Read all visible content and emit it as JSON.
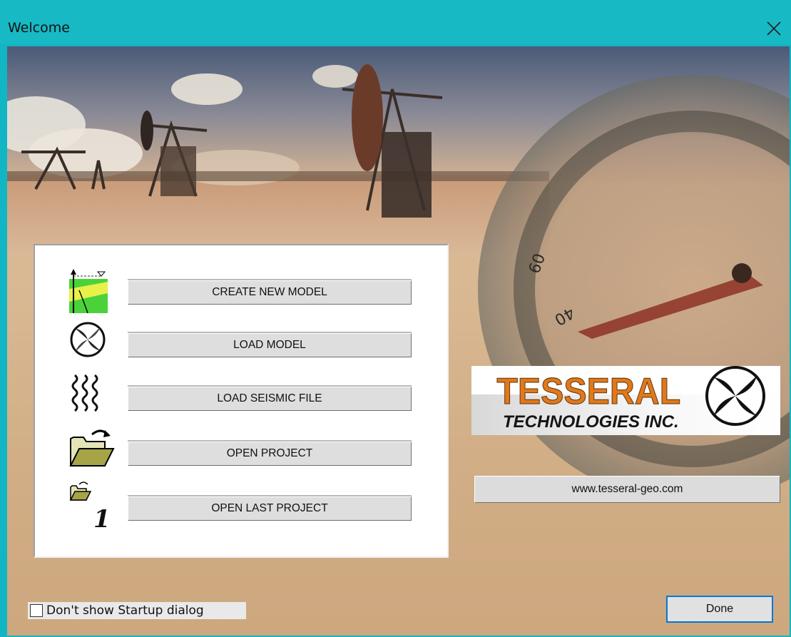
{
  "window": {
    "title": "Welcome"
  },
  "menu": {
    "create_new_model": "CREATE NEW MODEL",
    "load_model": "LOAD MODEL",
    "load_seismic_file": "LOAD SEISMIC FILE",
    "open_project": "OPEN PROJECT",
    "open_last_project": "OPEN LAST PROJECT",
    "last_project_number": "1"
  },
  "logo": {
    "line1": "TESSERAL",
    "line2": "TECHNOLOGIES INC."
  },
  "website_button": "www.tesseral-geo.com",
  "startup_checkbox": {
    "label": "Don't show Startup dialog",
    "checked": false
  },
  "done_button": "Done",
  "compass_marks": {
    "a": "60",
    "b": "40"
  },
  "colors": {
    "titlebar": "#17b9c4",
    "focus": "#0078d7",
    "logo_orange": "#e0781c"
  }
}
